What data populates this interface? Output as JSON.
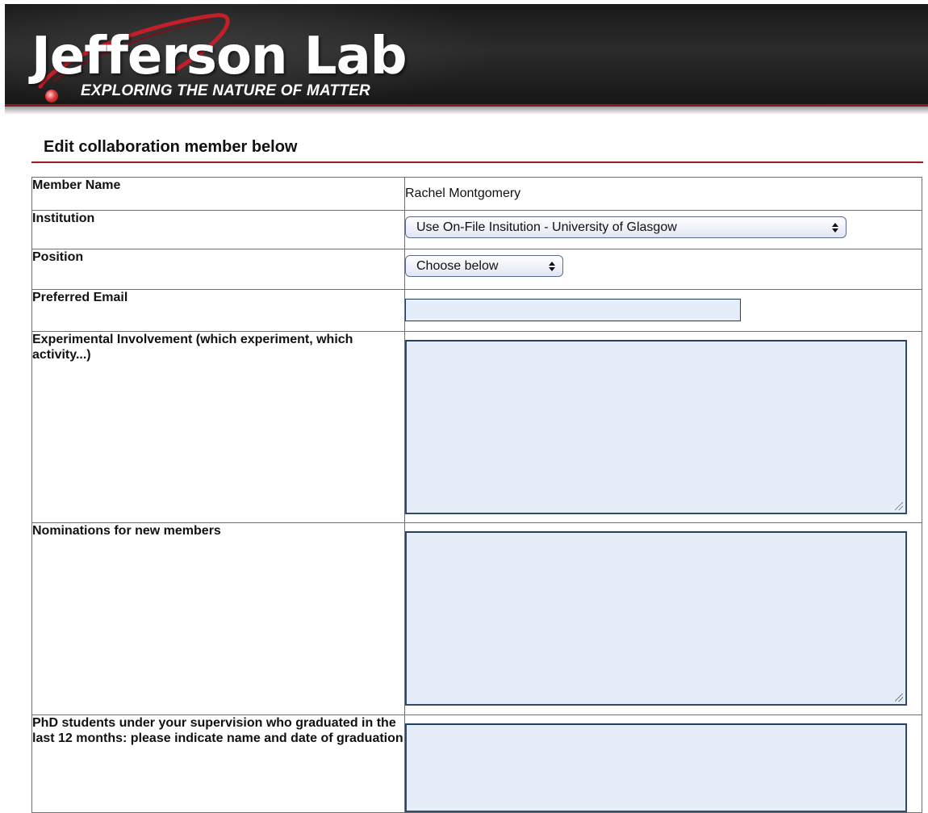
{
  "header": {
    "logo_title": "Jefferson Lab",
    "logo_tagline": "EXPLORING THE NATURE OF MATTER",
    "colors": {
      "banner": "#1f1f1f",
      "accent": "#8b1a1e"
    }
  },
  "page": {
    "heading": "Edit collaboration member below"
  },
  "form": {
    "member_name": {
      "label": "Member Name",
      "value": "Rachel Montgomery"
    },
    "institution": {
      "label": "Institution",
      "selected": "Use On-File Insitution - University of Glasgow"
    },
    "position": {
      "label": "Position",
      "selected": "Choose below"
    },
    "preferred_email": {
      "label": "Preferred Email",
      "value": ""
    },
    "experimental_involvement": {
      "label": "Experimental Involvement (which experiment, which activity...)",
      "value": ""
    },
    "nominations": {
      "label": "Nominations for new members",
      "value": ""
    },
    "phd_students": {
      "label": "PhD students under your supervision who graduated in the last 12 months: please indicate name and date of graduation",
      "value": ""
    }
  },
  "colors": {
    "field_bg": "#e5edf9",
    "rule": "#9b1b20"
  }
}
